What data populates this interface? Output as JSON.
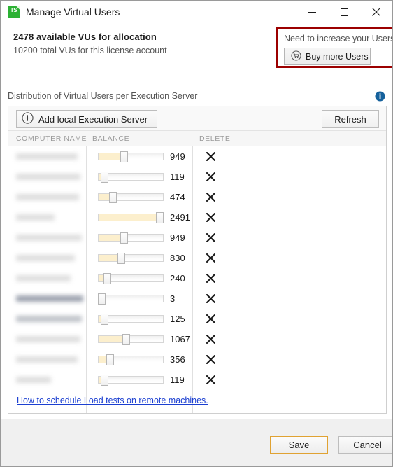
{
  "window": {
    "title": "Manage Virtual Users",
    "icon": "ts-app-icon",
    "minimize": "minimize-icon",
    "maximize": "maximize-icon",
    "close": "close-icon"
  },
  "license": {
    "available_line": "2478 available VUs for allocation",
    "total_line": "10200 total VUs for this license account",
    "available_vus": 2478,
    "total_vus": 10200
  },
  "buy_box": {
    "prompt": "Need to increase your Users?",
    "button_label": "Buy more Users",
    "icon": "shopping-cart-icon",
    "highlight_color": "#9c0000"
  },
  "distribution": {
    "section_label": "Distribution of Virtual Users per Execution Server",
    "info_icon": "info-icon",
    "add_button_label": "Add local Execution Server",
    "add_button_icon": "plus-circle-icon",
    "refresh_button_label": "Refresh"
  },
  "grid": {
    "columns": [
      "COMPUTER NAME",
      "BALANCE",
      "DELETE"
    ],
    "slider_max": 2500,
    "delete_icon": "x-icon",
    "rows": [
      {
        "computer_name": "",
        "redacted": true,
        "balance": 949,
        "balance_label": "949",
        "highlight": "none"
      },
      {
        "computer_name": "",
        "redacted": true,
        "balance": 119,
        "balance_label": "119",
        "highlight": "none"
      },
      {
        "computer_name": "",
        "redacted": true,
        "balance": 474,
        "balance_label": "474",
        "highlight": "none"
      },
      {
        "computer_name": "",
        "redacted": true,
        "balance": 2491,
        "balance_label": "2491",
        "highlight": "none"
      },
      {
        "computer_name": "",
        "redacted": true,
        "balance": 949,
        "balance_label": "949",
        "highlight": "none"
      },
      {
        "computer_name": "",
        "redacted": true,
        "balance": 830,
        "balance_label": "830",
        "highlight": "none"
      },
      {
        "computer_name": "",
        "redacted": true,
        "balance": 240,
        "balance_label": "240",
        "highlight": "none"
      },
      {
        "computer_name": "",
        "redacted": true,
        "balance": 3,
        "balance_label": "3",
        "highlight": "strong"
      },
      {
        "computer_name": "",
        "redacted": true,
        "balance": 125,
        "balance_label": "125",
        "highlight": "soft"
      },
      {
        "computer_name": "",
        "redacted": true,
        "balance": 1067,
        "balance_label": "1067",
        "highlight": "none"
      },
      {
        "computer_name": "",
        "redacted": true,
        "balance": 356,
        "balance_label": "356",
        "highlight": "none"
      },
      {
        "computer_name": "",
        "redacted": true,
        "balance": 119,
        "balance_label": "119",
        "highlight": "none"
      }
    ]
  },
  "help_link": {
    "text": "How to schedule Load tests on remote machines."
  },
  "footer": {
    "save_label": "Save",
    "cancel_label": "Cancel",
    "save_accent": "#e0a232"
  }
}
